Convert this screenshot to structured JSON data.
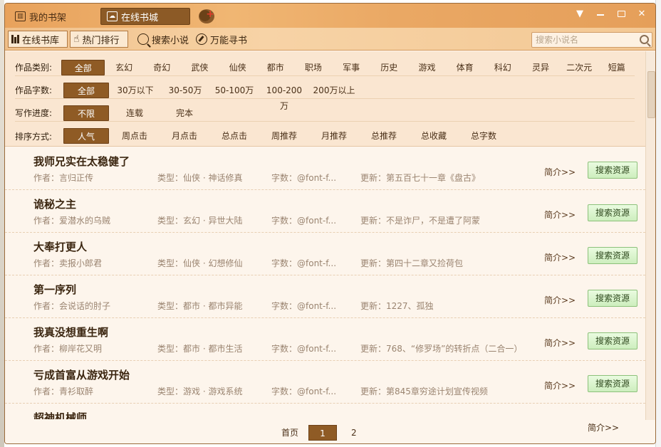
{
  "titlebar": {
    "shelf_label": "我的书架",
    "online_label": "在线书城"
  },
  "toolbar": {
    "library_label": "在线书库",
    "hot_rank_label": "热门排行",
    "search_novel_label": "搜索小说",
    "universal_search_label": "万能寻书",
    "search_placeholder": "搜索小说名"
  },
  "filters": {
    "category": {
      "label": "作品类别:",
      "options": [
        "全部",
        "玄幻",
        "奇幻",
        "武侠",
        "仙侠",
        "都市",
        "职场",
        "军事",
        "历史",
        "游戏",
        "体育",
        "科幻",
        "灵异",
        "二次元",
        "短篇"
      ],
      "selected": "全部"
    },
    "word_count": {
      "label": "作品字数:",
      "options": [
        "全部",
        "30万以下",
        "30-50万",
        "50-100万",
        "100-200万",
        "200万以上"
      ],
      "selected": "全部"
    },
    "progress": {
      "label": "写作进度:",
      "options": [
        "不限",
        "连载",
        "完本"
      ],
      "selected": "不限"
    },
    "sort": {
      "label": "排序方式:",
      "options": [
        "人气",
        "周点击",
        "月点击",
        "总点击",
        "周推荐",
        "月推荐",
        "总推荐",
        "总收藏",
        "总字数"
      ],
      "selected": "人气"
    }
  },
  "books": [
    {
      "title": "我师兄实在太稳健了",
      "author": "作者：言归正传",
      "type": "类型：仙侠 · 神话修真",
      "words": "字数：@font-f...",
      "update": "更新：第五百七十一章《盘古》",
      "intro": "简介>>",
      "search": "搜索资源"
    },
    {
      "title": "诡秘之主",
      "author": "作者：爱潜水的乌贼",
      "type": "类型：玄幻 · 异世大陆",
      "words": "字数：@font-f...",
      "update": "更新：不是诈尸，不是遭了阿蒙",
      "intro": "简介>>",
      "search": "搜索资源"
    },
    {
      "title": "大奉打更人",
      "author": "作者：卖报小郎君",
      "type": "类型：仙侠 · 幻想修仙",
      "words": "字数：@font-f...",
      "update": "更新：第四十二章又捡荷包",
      "intro": "简介>>",
      "search": "搜索资源"
    },
    {
      "title": "第一序列",
      "author": "作者：会说话的肘子",
      "type": "类型：都市 · 都市异能",
      "words": "字数：@font-f...",
      "update": "更新：1227、孤独",
      "intro": "简介>>",
      "search": "搜索资源"
    },
    {
      "title": "我真没想重生啊",
      "author": "作者：柳岸花又明",
      "type": "类型：都市 · 都市生活",
      "words": "字数：@font-f...",
      "update": "更新：768、“修罗场”的转折点（二合一）",
      "intro": "简介>>",
      "search": "搜索资源"
    },
    {
      "title": "亏成首富从游戏开始",
      "author": "作者：青衫取醉",
      "type": "类型：游戏 · 游戏系统",
      "words": "字数：@font-f...",
      "update": "更新：第845章穷途计划宣传视频",
      "intro": "简介>>",
      "search": "搜索资源"
    },
    {
      "title": "超神机械师",
      "author": "",
      "type": "",
      "words": "",
      "update": "",
      "intro": "",
      "search": ""
    }
  ],
  "pager": {
    "home": "首页",
    "current": "1",
    "next": "2",
    "intro_bottom": "简介>>"
  }
}
